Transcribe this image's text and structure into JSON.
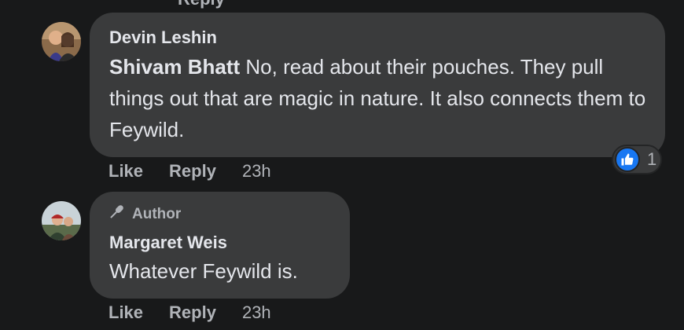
{
  "comments": [
    {
      "author": "Devin Leshin",
      "mention": "Shivam Bhatt",
      "text": " No, read about their pouches. They pull things out that are magic in nature. It also connects them to Feywild.",
      "reaction": {
        "icon": "thumbs-up-icon",
        "count": "1",
        "color": "#1877f2"
      },
      "actions": {
        "like": "Like",
        "reply": "Reply",
        "time": "23h"
      }
    },
    {
      "badge": "Author",
      "badge_icon": "microphone-icon",
      "author": "Margaret Weis",
      "text": "Whatever Feywild is.",
      "actions": {
        "like": "Like",
        "reply": "Reply",
        "time": "23h"
      }
    }
  ],
  "clipped_top_label": "Reply"
}
